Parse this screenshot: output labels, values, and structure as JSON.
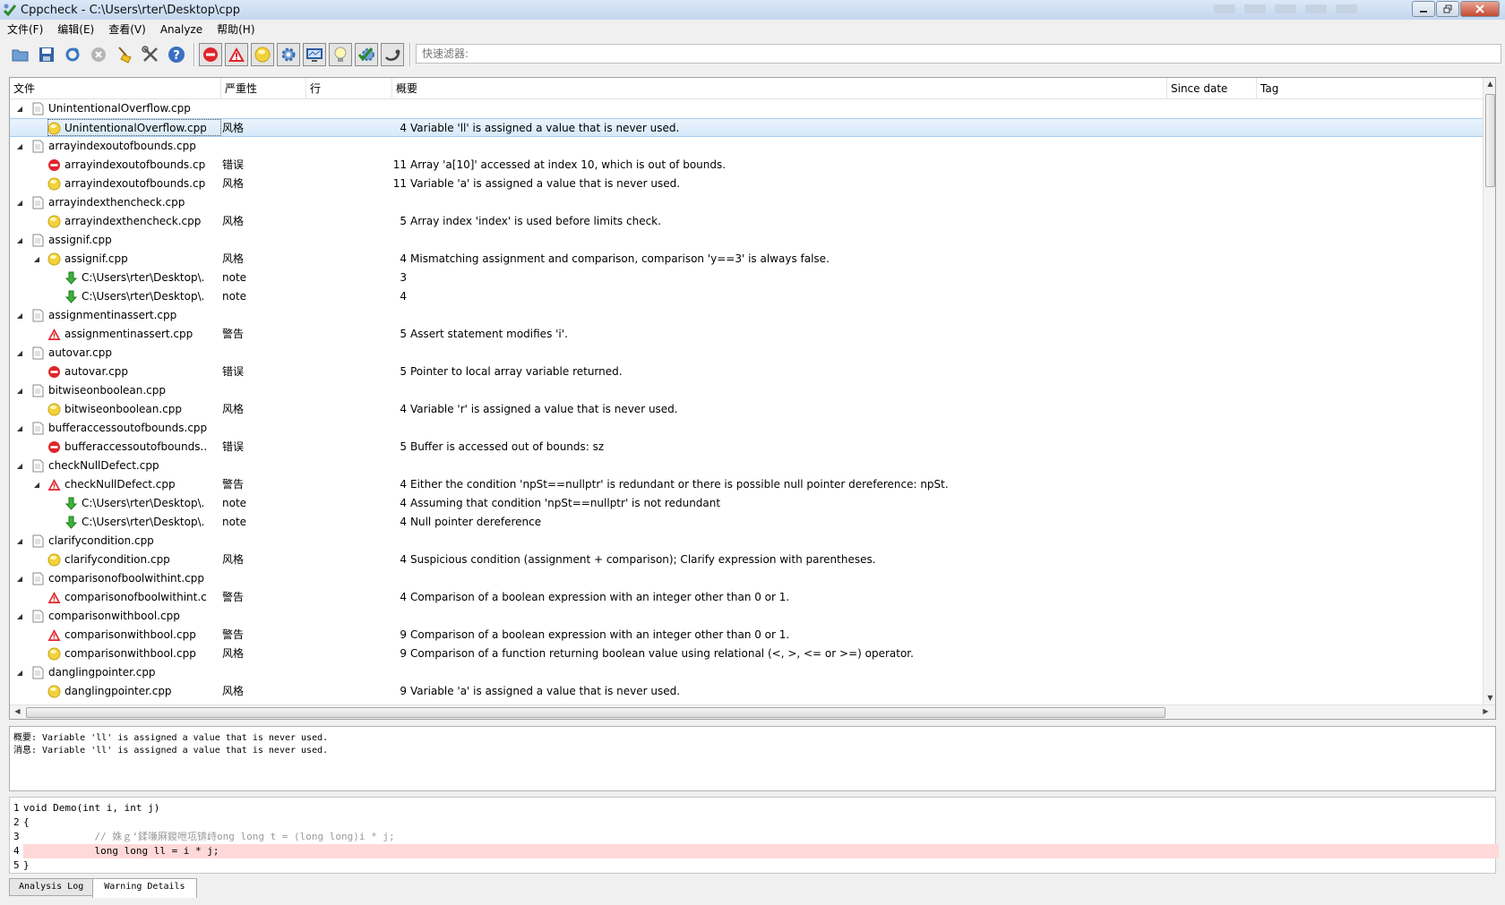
{
  "window": {
    "title": "Cppcheck - C:\\Users\\rter\\Desktop\\cpp"
  },
  "menu": [
    "文件(F)",
    "编辑(E)",
    "查看(V)",
    "Analyze",
    "帮助(H)"
  ],
  "toolbar": {
    "filter_placeholder": "快速滤器:"
  },
  "columns": {
    "file": "文件",
    "severity": "严重性",
    "line": "行",
    "summary": "概要",
    "since_date": "Since date",
    "tag": "Tag"
  },
  "rows": [
    {
      "level": 0,
      "icon": "file",
      "file": "UnintentionalOverflow.cpp",
      "severity": "",
      "line": "",
      "summary": ""
    },
    {
      "level": 1,
      "icon": "style",
      "file": "UnintentionalOverflow.cpp",
      "severity": "风格",
      "line": "4",
      "summary": "Variable 'll' is assigned a value that is never used.",
      "selected": true
    },
    {
      "level": 0,
      "icon": "file",
      "file": "arrayindexoutofbounds.cpp",
      "severity": "",
      "line": "",
      "summary": ""
    },
    {
      "level": 1,
      "icon": "error",
      "file": "arrayindexoutofbounds.cpp",
      "severity": "错误",
      "line": "11",
      "summary": "Array 'a[10]' accessed at index 10, which is out of bounds."
    },
    {
      "level": 1,
      "icon": "style",
      "file": "arrayindexoutofbounds.cpp",
      "severity": "风格",
      "line": "11",
      "summary": "Variable 'a' is assigned a value that is never used."
    },
    {
      "level": 0,
      "icon": "file",
      "file": "arrayindexthencheck.cpp",
      "severity": "",
      "line": "",
      "summary": ""
    },
    {
      "level": 1,
      "icon": "style",
      "file": "arrayindexthencheck.cpp",
      "severity": "风格",
      "line": "5",
      "summary": "Array index 'index' is used before limits check."
    },
    {
      "level": 0,
      "icon": "file",
      "file": "assignif.cpp",
      "severity": "",
      "line": "",
      "summary": ""
    },
    {
      "level": 1,
      "icon": "style",
      "file": "assignif.cpp",
      "severity": "风格",
      "line": "4",
      "summary": "Mismatching assignment and comparison, comparison 'y==3' is always false.",
      "expanded": true
    },
    {
      "level": 2,
      "icon": "note",
      "file": "C:\\Users\\rter\\Desktop\\...",
      "severity": "note",
      "line": "3",
      "summary": ""
    },
    {
      "level": 2,
      "icon": "note",
      "file": "C:\\Users\\rter\\Desktop\\...",
      "severity": "note",
      "line": "4",
      "summary": ""
    },
    {
      "level": 0,
      "icon": "file",
      "file": "assignmentinassert.cpp",
      "severity": "",
      "line": "",
      "summary": ""
    },
    {
      "level": 1,
      "icon": "warning",
      "file": "assignmentinassert.cpp",
      "severity": "警告",
      "line": "5",
      "summary": "Assert statement modifies 'i'."
    },
    {
      "level": 0,
      "icon": "file",
      "file": "autovar.cpp",
      "severity": "",
      "line": "",
      "summary": ""
    },
    {
      "level": 1,
      "icon": "error",
      "file": "autovar.cpp",
      "severity": "错误",
      "line": "5",
      "summary": "Pointer to local array variable returned."
    },
    {
      "level": 0,
      "icon": "file",
      "file": "bitwiseonboolean.cpp",
      "severity": "",
      "line": "",
      "summary": ""
    },
    {
      "level": 1,
      "icon": "style",
      "file": "bitwiseonboolean.cpp",
      "severity": "风格",
      "line": "4",
      "summary": "Variable 'r' is assigned a value that is never used."
    },
    {
      "level": 0,
      "icon": "file",
      "file": "bufferaccessoutofbounds.cpp",
      "severity": "",
      "line": "",
      "summary": ""
    },
    {
      "level": 1,
      "icon": "error",
      "file": "bufferaccessoutofbounds....",
      "severity": "错误",
      "line": "5",
      "summary": "Buffer is accessed out of bounds: sz"
    },
    {
      "level": 0,
      "icon": "file",
      "file": "checkNullDefect.cpp",
      "severity": "",
      "line": "",
      "summary": ""
    },
    {
      "level": 1,
      "icon": "warning",
      "file": "checkNullDefect.cpp",
      "severity": "警告",
      "line": "4",
      "summary": "Either the condition 'npSt==nullptr' is redundant or there is possible null pointer dereference: npSt.",
      "expanded": true
    },
    {
      "level": 2,
      "icon": "note",
      "file": "C:\\Users\\rter\\Desktop\\...",
      "severity": "note",
      "line": "4",
      "summary": "Assuming that condition 'npSt==nullptr' is not redundant"
    },
    {
      "level": 2,
      "icon": "note",
      "file": "C:\\Users\\rter\\Desktop\\...",
      "severity": "note",
      "line": "4",
      "summary": "Null pointer dereference"
    },
    {
      "level": 0,
      "icon": "file",
      "file": "clarifycondition.cpp",
      "severity": "",
      "line": "",
      "summary": ""
    },
    {
      "level": 1,
      "icon": "style",
      "file": "clarifycondition.cpp",
      "severity": "风格",
      "line": "4",
      "summary": "Suspicious condition (assignment + comparison); Clarify expression with parentheses."
    },
    {
      "level": 0,
      "icon": "file",
      "file": "comparisonofboolwithint.cpp",
      "severity": "",
      "line": "",
      "summary": ""
    },
    {
      "level": 1,
      "icon": "warning",
      "file": "comparisonofboolwithint.c...",
      "severity": "警告",
      "line": "4",
      "summary": "Comparison of a boolean expression with an integer other than 0 or 1."
    },
    {
      "level": 0,
      "icon": "file",
      "file": "comparisonwithbool.cpp",
      "severity": "",
      "line": "",
      "summary": ""
    },
    {
      "level": 1,
      "icon": "warning",
      "file": "comparisonwithbool.cpp",
      "severity": "警告",
      "line": "9",
      "summary": "Comparison of a boolean expression with an integer other than 0 or 1."
    },
    {
      "level": 1,
      "icon": "style",
      "file": "comparisonwithbool.cpp",
      "severity": "风格",
      "line": "9",
      "summary": "Comparison of a function returning boolean value using relational (<, >, <= or >=) operator."
    },
    {
      "level": 0,
      "icon": "file",
      "file": "danglingpointer.cpp",
      "severity": "",
      "line": "",
      "summary": ""
    },
    {
      "level": 1,
      "icon": "style",
      "file": "danglingpointer.cpp",
      "severity": "风格",
      "line": "9",
      "summary": "Variable 'a' is assigned a value that is never used."
    }
  ],
  "details": {
    "summary_line": "概要: Variable 'll' is assigned a value that is never used.",
    "message_line": "消息: Variable 'll' is assigned a value that is never used."
  },
  "code": {
    "highlight_line": 4,
    "lines": [
      {
        "num": "1",
        "text": "void Demo(int i, int j)"
      },
      {
        "num": "2",
        "text": "{"
      },
      {
        "num": "3",
        "text": "            // 姝ｇ‘鍒嗛厤鍐呭瓨锛歭ong long t = (long long)i * j;"
      },
      {
        "num": "4",
        "text": "            long long ll = i * j;"
      },
      {
        "num": "5",
        "text": "}"
      }
    ]
  },
  "tabs": [
    {
      "label": "Analysis Log",
      "active": false
    },
    {
      "label": "Warning Details",
      "active": true
    }
  ],
  "colors": {
    "error": "#e0242a",
    "warning": "#e0242a",
    "style": "#f2d23c",
    "note": "#3bb33b",
    "highlight": "#ffd9d9",
    "selection": "#d6e9fa"
  }
}
